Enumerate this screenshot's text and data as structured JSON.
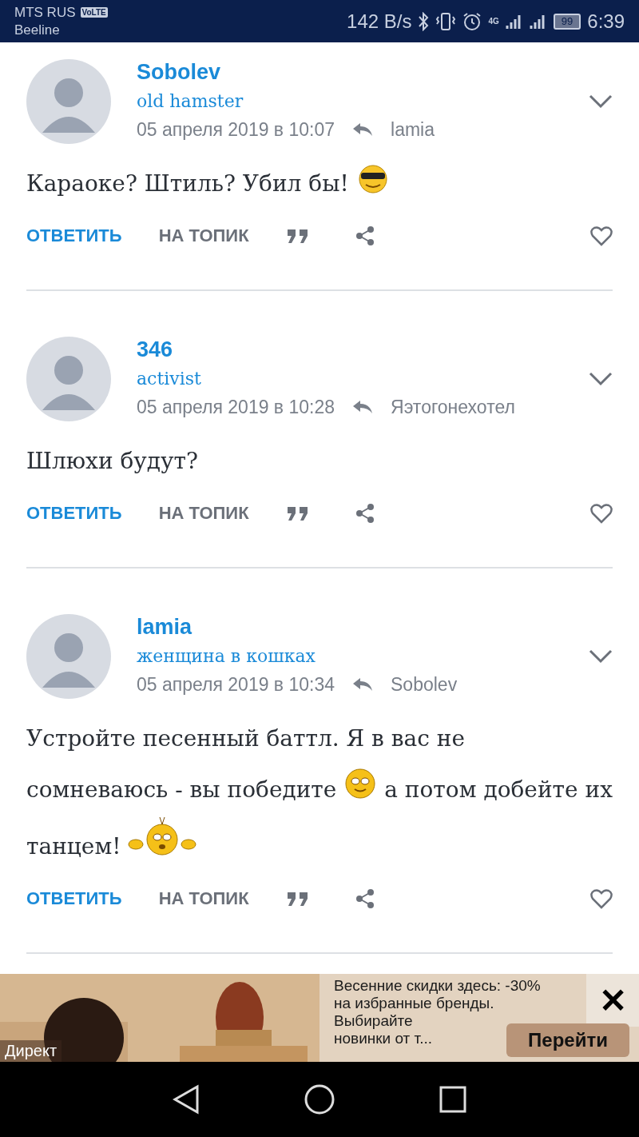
{
  "status_bar": {
    "carrier": "MTS RUS",
    "volte": "VoLTE",
    "carrier_2": "Beeline",
    "speed": "142 B/s",
    "network": "4G",
    "battery": "99",
    "time": "6:39"
  },
  "comments": [
    {
      "author": "Sobolev",
      "role": "old hamster",
      "date": "05 апреля 2019 в 10:07",
      "reply_to": "lamia",
      "body": [
        {
          "kind": "text",
          "text": "Караоке? Штиль? Убил бы! "
        },
        {
          "kind": "cool"
        }
      ],
      "actions": {
        "reply": "ОТВЕТИТЬ",
        "topic": "НА ТОПИК"
      },
      "liked": false
    },
    {
      "author": "346",
      "role": "activist",
      "date": "05 апреля 2019 в 10:28",
      "reply_to": "Яэтогонехотел",
      "body": [
        {
          "kind": "text",
          "text": "Шлюхи будут?"
        }
      ],
      "actions": {
        "reply": "ОТВЕТИТЬ",
        "topic": "НА ТОПИК"
      },
      "liked": false
    },
    {
      "author": "lamia",
      "role": "женщина в кошках",
      "date": "05 апреля 2019 в 10:34",
      "reply_to": "Sobolev",
      "body": [
        {
          "kind": "text",
          "text": "Устройте песенный баттл. Я в вас не сомневаюсь - вы победите "
        },
        {
          "kind": "smile"
        },
        {
          "kind": "text",
          "text": " а потом добейте их танцем! "
        },
        {
          "kind": "dance"
        }
      ],
      "actions": {
        "reply": "ОТВЕТИТЬ",
        "topic": "НА ТОПИК"
      },
      "liked": false
    }
  ],
  "ad": {
    "label": "Директ",
    "text_lines": [
      "Весенние скидки здесь: -30%",
      "на избранные бренды.",
      "Выбирайте",
      "новинки от т..."
    ],
    "close": "✕",
    "button": "Перейти"
  }
}
